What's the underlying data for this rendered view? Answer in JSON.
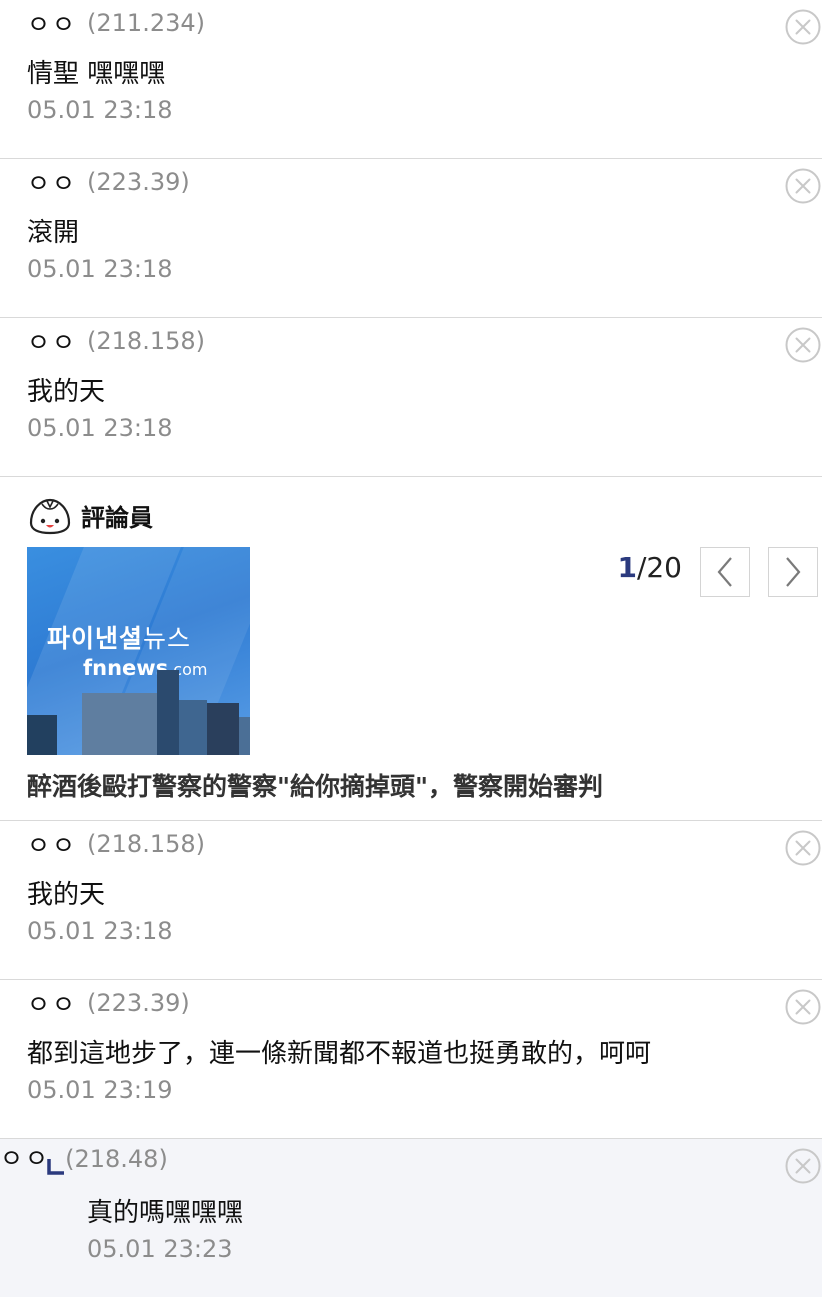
{
  "comments_top": [
    {
      "nick": "ㅇㅇ",
      "ip": "(211.234)",
      "text": "情聖 嘿嘿嘿",
      "date": "05.01 23:18"
    },
    {
      "nick": "ㅇㅇ",
      "ip": "(223.39)",
      "text": "滾開",
      "date": "05.01 23:18"
    },
    {
      "nick": "ㅇㅇ",
      "ip": "(218.158)",
      "text": "我的天",
      "date": "05.01 23:18"
    }
  ],
  "ad": {
    "label": "評論員",
    "thumb_korean": "파이낸셜",
    "thumb_korean_small": "뉴스",
    "thumb_url": "fnnews",
    "thumb_url_tld": ".com",
    "page_current": "1",
    "page_total": "/20",
    "title": "醉酒後毆打警察的警察\"給你摘掉頭\"，警察開始審判"
  },
  "comments_bottom": [
    {
      "nick": "ㅇㅇ",
      "ip": "(218.158)",
      "text": "我的天",
      "date": "05.01 23:18"
    },
    {
      "nick": "ㅇㅇ",
      "ip": "(223.39)",
      "text": "都到這地步了，連一條新聞都不報道也挺勇敢的，呵呵",
      "date": "05.01 23:19"
    }
  ],
  "reply": {
    "nick": "ㅇㅇ",
    "ip": "(218.48)",
    "text": "真的嗎嘿嘿嘿",
    "date": "05.01 23:23"
  },
  "icons": {
    "delete": "close-circle-icon",
    "prev": "chevron-left-icon",
    "next": "chevron-right-icon",
    "reply": "reply-arrow-icon",
    "mascot": "dumpling-mascot-icon"
  },
  "colors": {
    "meta_gray": "#8c8c8c",
    "divider": "#d9d9d9",
    "reply_bg": "#f4f5f9",
    "page_accent": "#2b3a7e"
  }
}
